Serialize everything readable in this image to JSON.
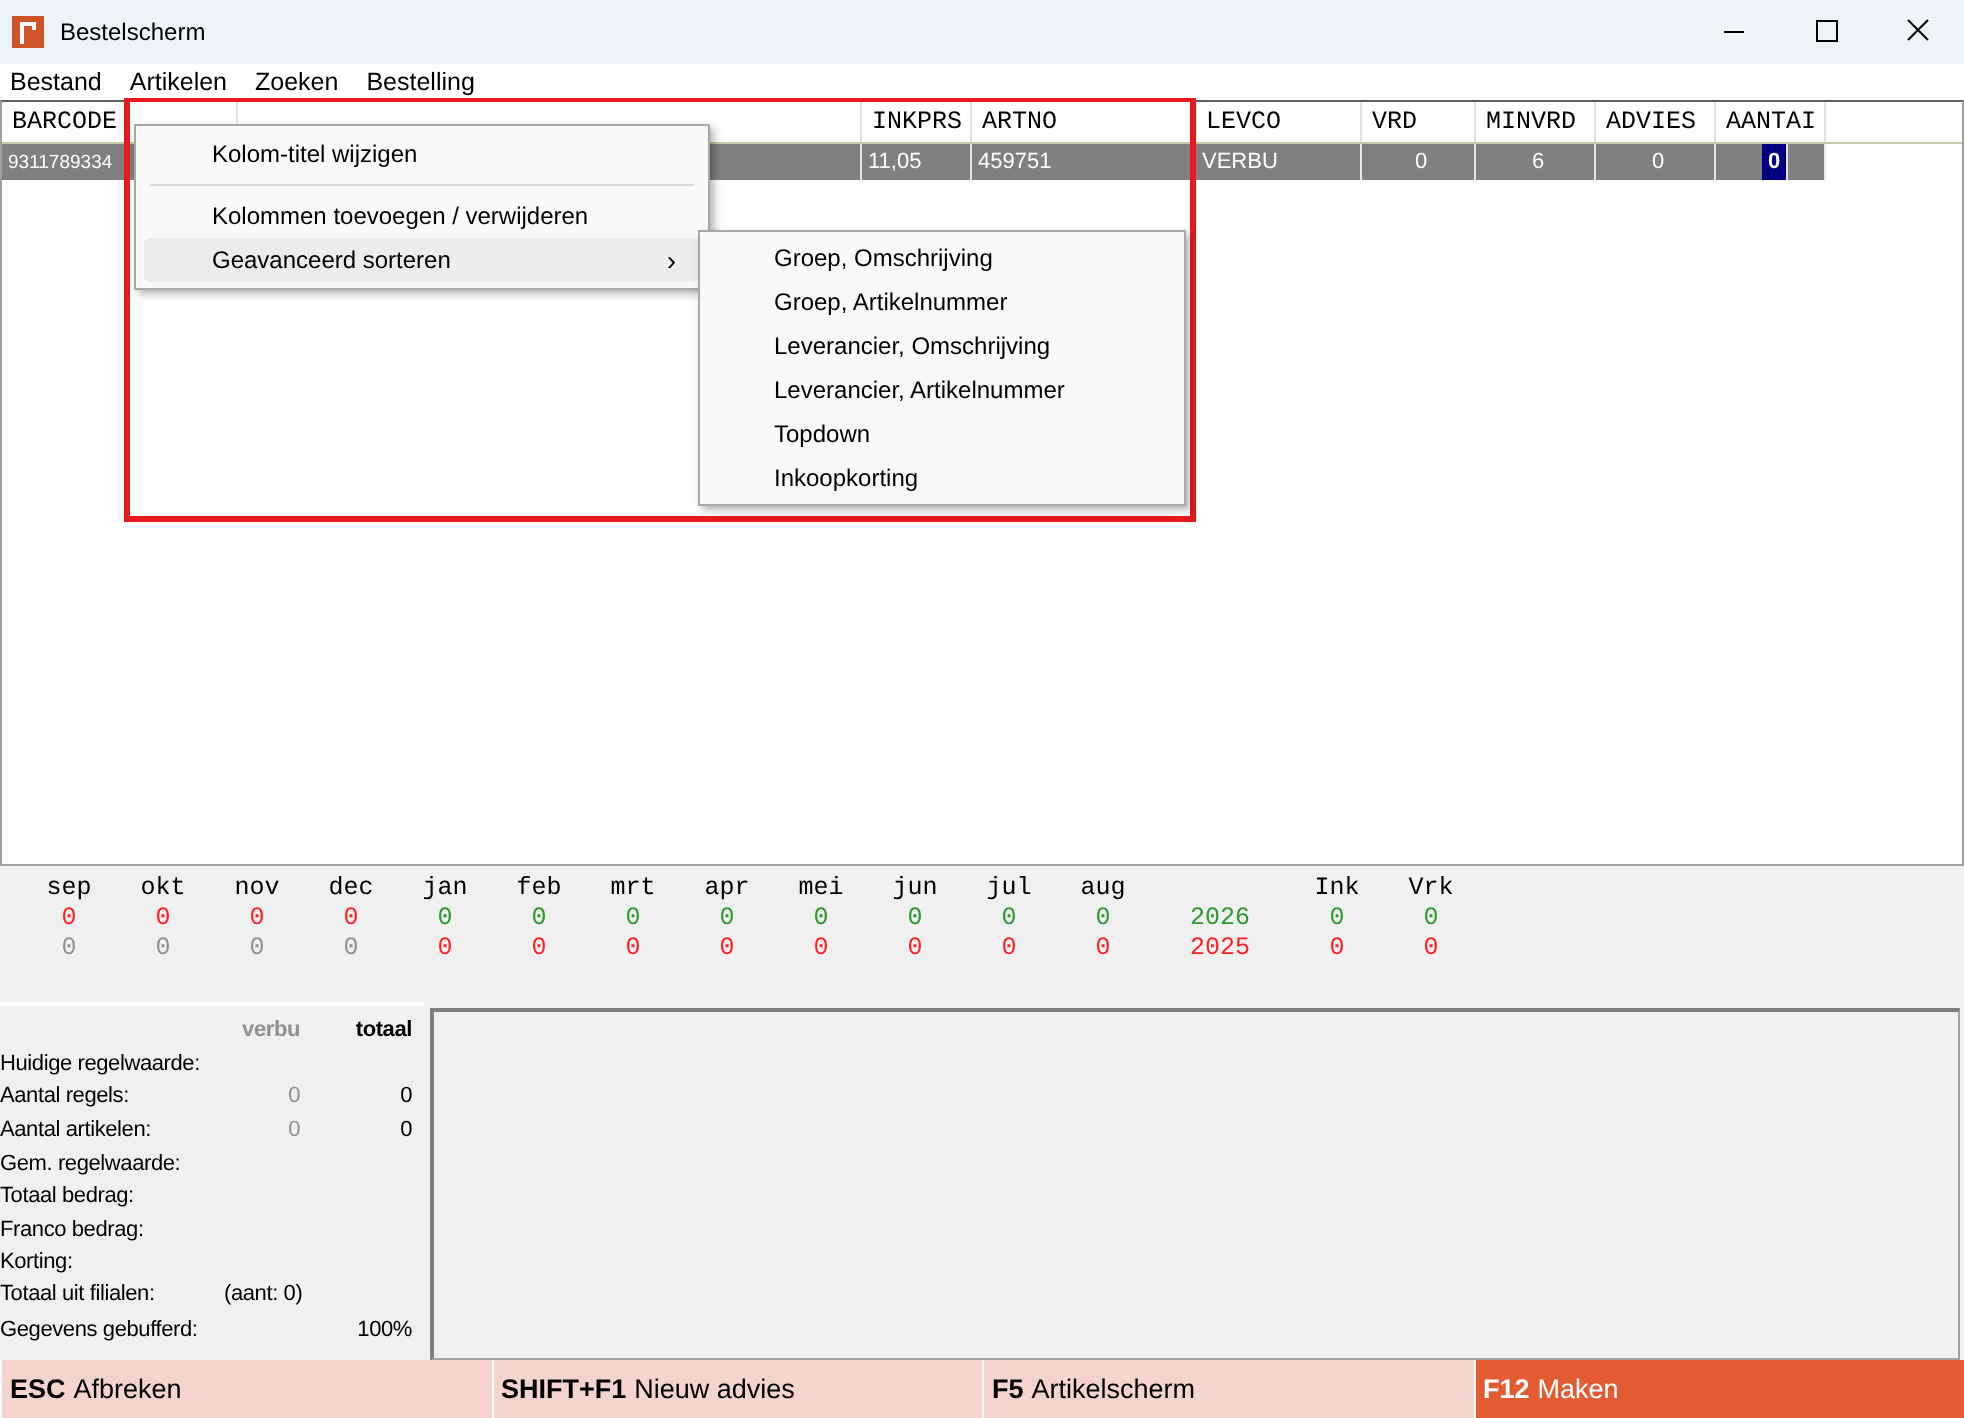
{
  "window": {
    "title": "Bestelscherm"
  },
  "menu": [
    "Bestand",
    "Artikelen",
    "Zoeken",
    "Bestelling"
  ],
  "grid": {
    "columns": [
      "BARCODE",
      "",
      "INKPRS",
      "ARTNO",
      "LEVCO",
      "VRD",
      "MINVRD",
      "ADVIES",
      "AANTAI"
    ],
    "rows": [
      {
        "selected": true,
        "cells": [
          "9311789334",
          "",
          "11,05",
          "459751",
          "VERBU",
          "0",
          "6",
          "0",
          "0"
        ]
      }
    ]
  },
  "context_menu": {
    "items": [
      {
        "label": "Kolom-titel wijzigen",
        "kind": "item",
        "selected": false
      },
      {
        "label": "Kolommen toevoegen / verwijderen",
        "kind": "item",
        "selected": false
      },
      {
        "label": "Geavanceerd sorteren",
        "kind": "submenu",
        "selected": true,
        "arrow": "›"
      }
    ],
    "submenu": [
      "Groep, Omschrijving",
      "Groep, Artikelnummer",
      "Leverancier, Omschrijving",
      "Leverancier, Artikelnummer",
      "Topdown",
      "Inkoopkorting"
    ]
  },
  "months": {
    "headers": [
      "sep",
      "okt",
      "nov",
      "dec",
      "jan",
      "feb",
      "mrt",
      "apr",
      "mei",
      "jun",
      "jul",
      "aug",
      "Ink",
      "Vrk"
    ],
    "rows": [
      [
        {
          "text": "0",
          "color": "#ff2020"
        },
        {
          "text": "0",
          "color": "#ff2020"
        },
        {
          "text": "0",
          "color": "#ff2020"
        },
        {
          "text": "0",
          "color": "#ff2020"
        },
        {
          "text": "0",
          "color": "#2a9a2a"
        },
        {
          "text": "0",
          "color": "#2a9a2a"
        },
        {
          "text": "0",
          "color": "#2a9a2a"
        },
        {
          "text": "0",
          "color": "#2a9a2a"
        },
        {
          "text": "0",
          "color": "#2a9a2a"
        },
        {
          "text": "0",
          "color": "#2a9a2a"
        },
        {
          "text": "0",
          "color": "#2a9a2a"
        },
        {
          "text": "0",
          "color": "#2a9a2a"
        },
        {
          "text": "2026",
          "color": "#2a9a2a"
        },
        {
          "text": "0",
          "color": "#2a9a2a"
        },
        {
          "text": "0",
          "color": "#2a9a2a"
        }
      ],
      [
        {
          "text": "0",
          "color": "#909090"
        },
        {
          "text": "0",
          "color": "#909090"
        },
        {
          "text": "0",
          "color": "#909090"
        },
        {
          "text": "0",
          "color": "#909090"
        },
        {
          "text": "0",
          "color": "#ff2020"
        },
        {
          "text": "0",
          "color": "#ff2020"
        },
        {
          "text": "0",
          "color": "#ff2020"
        },
        {
          "text": "0",
          "color": "#ff2020"
        },
        {
          "text": "0",
          "color": "#ff2020"
        },
        {
          "text": "0",
          "color": "#ff2020"
        },
        {
          "text": "0",
          "color": "#ff2020"
        },
        {
          "text": "0",
          "color": "#ff2020"
        },
        {
          "text": "2025",
          "color": "#ff2020"
        },
        {
          "text": "0",
          "color": "#ff2020"
        },
        {
          "text": "0",
          "color": "#ff2020"
        }
      ]
    ]
  },
  "summary": {
    "headers": [
      "verbu",
      "totaal"
    ],
    "rows": [
      {
        "label": "Huidige regelwaarde:"
      },
      {
        "label": "Aantal regels:",
        "verbu": "0",
        "totaal": "0"
      },
      {
        "label": "Aantal artikelen:",
        "verbu": "0",
        "totaal": "0"
      },
      {
        "label": "Gem. regelwaarde:"
      },
      {
        "label": "Totaal bedrag:"
      },
      {
        "label": "Franco bedrag:"
      },
      {
        "label": "Korting:"
      },
      {
        "label": "Totaal uit filialen:",
        "verbu": "(aant: 0)"
      },
      {
        "label": "Gegevens gebufferd:",
        "totaal": "100%"
      }
    ]
  },
  "footer": [
    {
      "key": "ESC",
      "label": "Afbreken",
      "primary": false
    },
    {
      "key": "SHIFT+F1",
      "label": "Nieuw advies",
      "primary": false
    },
    {
      "key": "F5",
      "label": "Artikelscherm",
      "primary": false
    },
    {
      "key": "F12",
      "label": "Maken",
      "primary": true
    }
  ]
}
